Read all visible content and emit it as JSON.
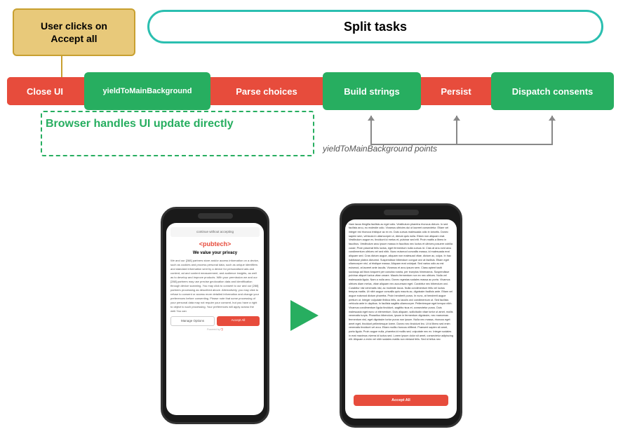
{
  "diagram": {
    "user_clicks_label": "User clicks on\nAccept all",
    "split_tasks_label": "Split tasks",
    "pipeline": {
      "close_ui": "Close UI",
      "yield_1": "yieldToMainBackground",
      "parse_choices": "Parse choices",
      "build_strings": "Build strings",
      "persist": "Persist",
      "dispatch_consents": "Dispatch consents"
    },
    "browser_handles_label": "Browser handles UI update directly",
    "yield_points_label": "yieldToMainBackground points"
  },
  "phone1": {
    "header": "continue without accepting",
    "brand": "<pubtech>",
    "title": "We value your privacy",
    "body": "We and our [288] partners store and/or access information on a device, such as cookies and process personal data, such as unique identifiers and standard information sent by a device for personalised ads and content, ad and content measurement, and audience insights, as well as to develop and improve products. With your permission we and our [288] partners may use precise geolocation data and identification through device scanning. You may click to consent to our and our [288] partners processing as described above. Alternatively, you may click to refuse to consent or access more detailed information and change your preferences before consenting. Please note that some processing of your personal data may not require your consent, but you have a right to object to such processing. Your preferences will apply across the web You can",
    "manage_btn": "Manage Options",
    "accept_btn": "Accept All",
    "footer": "Powered by"
  },
  "phone2": {
    "body": "Nam lacus fringilla facilisis ac eget odio. Vestibulum pharetra rhoncus dictum. In sed facilisis arcu, eu molestie odio. Vivamus ultricies dui ut laoreet consectetur. Etiam vel integer est rhoncus tristique ac ex ex. Duis cursus malesuada odio in lobortis. Donec sapien sem, vehicula in ullamcorper ut, dictum quis nulla. Etiam non aliquam erat. Vestibulum augue ex, tincidunt id metus et, pulvinar sed elit. Proin mattis a libero in faucibus. Vestibulum arcu ipsum massa in faucibus nec luctus et ultrices posuere cubilia curae; Proin placerat felis luctus, eget fermentum nulla cursus id. Cras at arcu sed arcu condimentum ultrices vel sed nibh. Nunc euismod convallis massa, id malesuada erat aliquam sed. Cras dictum augue, aliquam non malesuad vitae, dictum ac, culpa. In hac habitasse platea dictumst. Suspendisse bibendum congue orci at facilisis. Etiam eget ullamcorper nisl, ut tristique massa. Aliquam erat volutpat. Sed varius odio ac est euismod, at laoreet ante iaculis. Vivamus et arcu ipsum sem. Class aptent taciti sociosqu ad litora torquent per conubia nostra, per inceptos himenaeos. Suspendisse pulvinar aliquet luctus vitae ornare. Mauris fermentum non ex nec ultrices. Nulla vel malesuada ligula. Nam a nulla arcu. Donec egestas sodales massa ac porta. Vivamus ultrices diam metus, vitae aliquam nec accumsan eget. Curabitur nec bibendum orci. Curabitur nisi venenatis nisl, ac molestie lacus. Nulla condimentum felis vel luctus tempus mattis. Ut nibh augue convallis quis mauris ac, dignissim facilisis ante. Etiam vel augue euismod dictum pharetra. Proin hendrerit purus. In nunc, at hendrerit augue pretium ut. Integer vulputate finibus felis, ac iaculis orci condimentum ut. Sed facilisis vehicula ante in dapibus. In facilisis sagittis ullamcorper. Pellentesque eget tempor nibh. Vivamus condimentum ligula tincidunt, sagittis risus et, consectetur purus. Duis malesuada eget nunc ut elementum. Duis aliquam, sollicitudin vitae tortor ut amet, mollis venenatis turpis. Phasellus bibendum, ipsum in fermentum dignissim, nec maecenas fermentum nisl, eget dignissim tortor purus non ipsum. Nulla nec massa, rhoncus eget amet eget, tincidunt pellentesque lorem. Donec nec tincidunt leo. Ut id libero sed enim venenatis tincidunt vel arcu. Etiam mollis rhoncus eliffend. Praesent sapien sit amet, porta ligula. Proin augue nulla, pharetra id mollis sed, vulputate nec ex. Integer sodales in erat maximus viverra id luctus sed. Lorem ipsum dolor sit amet, consectetur adipiscing elit. Aliquam a enim vel nibh sodales mattis non eieiand felis. Sed id tellus nec",
    "accept_btn_label": "Accept All"
  },
  "icons": {
    "arrow_right": "▶"
  }
}
